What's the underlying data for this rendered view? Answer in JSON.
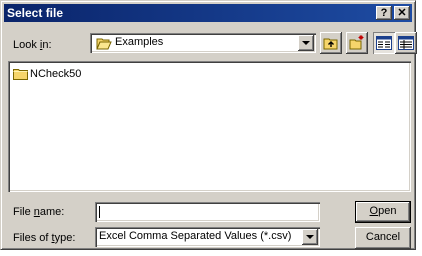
{
  "window": {
    "title": "Select file",
    "help_label": "?",
    "close_label": "✕"
  },
  "look_in": {
    "label_pre": "Look ",
    "label_access": "i",
    "label_post": "n:",
    "value": "Examples"
  },
  "toolbar": {
    "up_icon": "up-folder-icon",
    "new_folder_icon": "new-folder-icon",
    "list_icon": "list-view-icon",
    "details_icon": "details-view-icon"
  },
  "files": [
    {
      "name": "NCheck50",
      "icon": "folder-icon"
    }
  ],
  "file_name": {
    "label_pre": "File ",
    "label_access": "n",
    "label_post": "ame:",
    "value": ""
  },
  "file_type": {
    "label_pre": "Files of ",
    "label_access": "t",
    "label_post": "ype:",
    "value": "Excel Comma Separated Values (*.csv)"
  },
  "buttons": {
    "open_access": "O",
    "open_rest": "pen",
    "cancel": "Cancel"
  }
}
